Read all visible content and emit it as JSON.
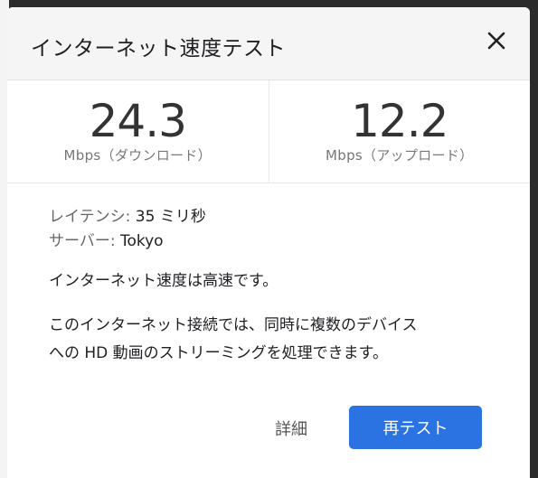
{
  "dialog": {
    "title": "インターネット速度テスト"
  },
  "download": {
    "value": "24.3",
    "label": "Mbps（ダウンロード）"
  },
  "upload": {
    "value": "12.2",
    "label": "Mbps（アップロード）"
  },
  "latency": {
    "key": "レイテンシ:",
    "value": "35 ミリ秒"
  },
  "server": {
    "key": "サーバー:",
    "value": "Tokyo"
  },
  "status": "インターネット速度は高速です。",
  "description": {
    "line1": "このインターネット接続では、同時に複数のデバイス",
    "line2": "への HD 動画のストリーミングを処理できます。"
  },
  "footer": {
    "details_label": "詳細",
    "retest_label": "再テスト"
  },
  "icons": {
    "close": "close-icon"
  },
  "colors": {
    "accent": "#2b73e3",
    "header_bg": "#f5f5f5"
  }
}
